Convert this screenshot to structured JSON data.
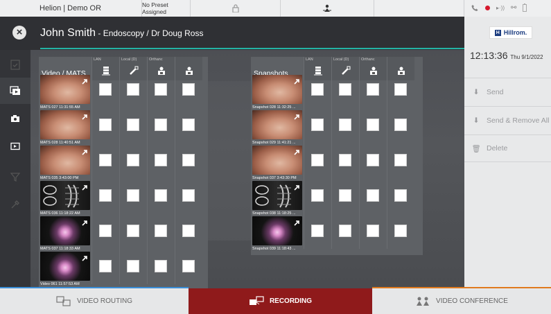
{
  "topbar": {
    "system_name": "Helion | Demo OR",
    "preset": "No Preset Assigned"
  },
  "header": {
    "patient_name": "John Smith",
    "procedure": " - Endoscopy / Dr Doug Ross"
  },
  "video_panel": {
    "title": "Video / MATS",
    "columns": [
      {
        "label": "LAN",
        "icon": "network-server-icon"
      },
      {
        "label": "Local (D)",
        "icon": "usb-drive-icon"
      },
      {
        "label": "Orthanc",
        "icon": "pacs-archive-icon"
      },
      {
        "label": "",
        "icon": "pacs-archive-icon"
      }
    ],
    "items": [
      {
        "caption": "MATS 027 11:31:55 AM",
        "kind": "endo"
      },
      {
        "caption": "MATS 028 11:40:51 AM",
        "kind": "endo"
      },
      {
        "caption": "MATS 035 3:43:00 PM",
        "kind": "endo"
      },
      {
        "caption": "MATS 036 11:18:22 AM",
        "kind": "xray"
      },
      {
        "caption": "MATS 037 11:18:33 AM",
        "kind": "glow"
      },
      {
        "caption": "Video 061 11:57:53 AM",
        "kind": "glow"
      }
    ]
  },
  "snap_panel": {
    "title": "Snapshots",
    "columns": [
      {
        "label": "LAN",
        "icon": "network-server-icon"
      },
      {
        "label": "Local (D)",
        "icon": "usb-drive-icon"
      },
      {
        "label": "Orthanc",
        "icon": "pacs-archive-icon"
      },
      {
        "label": "",
        "icon": "pacs-archive-icon"
      }
    ],
    "items": [
      {
        "caption": "Snapshot 028 11:32:25 ...",
        "kind": "endo"
      },
      {
        "caption": "Snapshot 029 11:41:21 ...",
        "kind": "endo"
      },
      {
        "caption": "Snapshot 037 3:43:30 PM",
        "kind": "endo"
      },
      {
        "caption": "Snapshot 038 11:18:25 ...",
        "kind": "xray"
      },
      {
        "caption": "Snapshot 039 11:18:43 ...",
        "kind": "glow"
      }
    ]
  },
  "right_panel": {
    "brand": "Hillrom.",
    "brand_mark": "H",
    "time": "12:13:36",
    "date": "Thu 9/1/2022",
    "send_label": "Send",
    "send_remove_label": "Send & Remove All",
    "delete_label": "Delete"
  },
  "bottom": {
    "video_routing": "VIDEO ROUTING",
    "recording": "RECORDING",
    "video_conference": "VIDEO CONFERENCE"
  },
  "colors": {
    "accent_teal": "#23b3a5",
    "recording_red": "#8f1a1b",
    "routing_blue": "#3a8ed8",
    "conference_orange": "#e07a1e"
  }
}
